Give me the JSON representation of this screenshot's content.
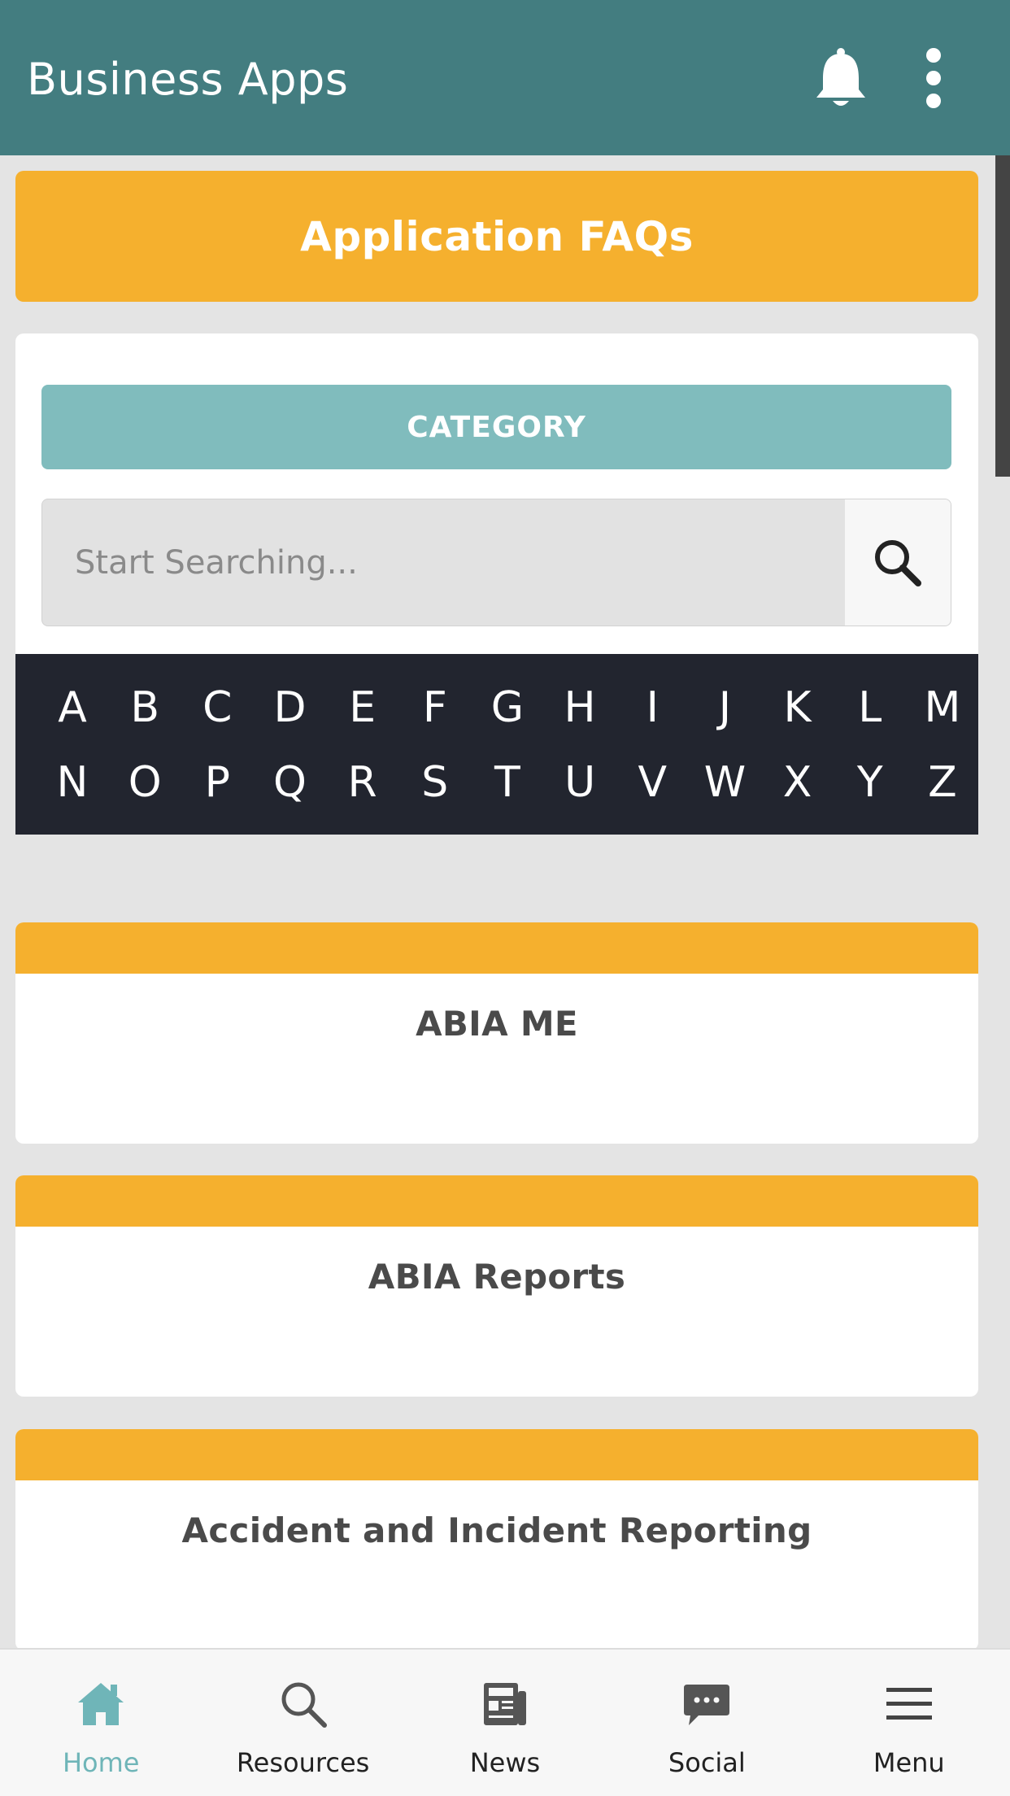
{
  "app_bar": {
    "title": "Business Apps",
    "notifications_icon": "bell-icon",
    "overflow_icon": "kebab-menu-icon",
    "background": "#437d80"
  },
  "faq_button": {
    "label": "Application FAQs",
    "color": "#f5b02e"
  },
  "filters": {
    "category_label": "CATEGORY",
    "category_color": "#80bcbd",
    "search_placeholder": "Start Searching...",
    "search_icon": "search-icon"
  },
  "alphabet": {
    "row1": [
      "A",
      "B",
      "C",
      "D",
      "E",
      "F",
      "G",
      "H",
      "I",
      "J",
      "K",
      "L",
      "M"
    ],
    "row2": [
      "N",
      "O",
      "P",
      "Q",
      "R",
      "S",
      "T",
      "U",
      "V",
      "W",
      "X",
      "Y",
      "Z"
    ]
  },
  "apps": [
    {
      "title": "ABIA ME"
    },
    {
      "title": "ABIA Reports"
    },
    {
      "title": "Accident and Incident Reporting"
    }
  ],
  "bottom_nav": {
    "items": [
      {
        "label": "Home",
        "icon": "home-icon",
        "active": true
      },
      {
        "label": "Resources",
        "icon": "search-icon",
        "active": false
      },
      {
        "label": "News",
        "icon": "newspaper-icon",
        "active": false
      },
      {
        "label": "Social",
        "icon": "chat-bubble-icon",
        "active": false
      },
      {
        "label": "Menu",
        "icon": "hamburger-menu-icon",
        "active": false
      }
    ],
    "active_color": "#6fb5b8"
  }
}
